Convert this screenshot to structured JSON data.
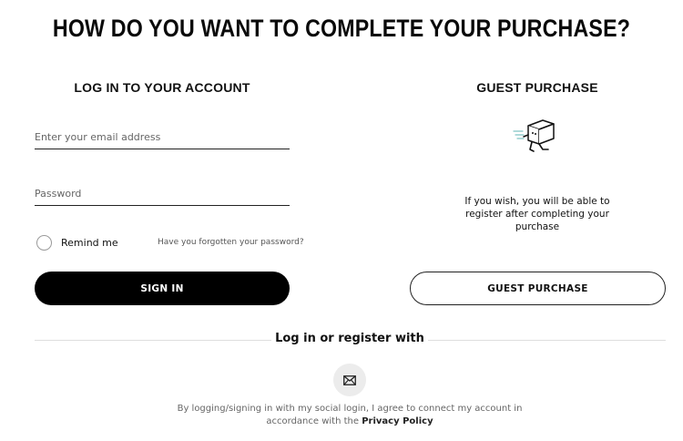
{
  "page": {
    "title": "HOW DO YOU WANT TO COMPLETE YOUR PURCHASE?"
  },
  "login": {
    "heading": "LOG IN TO YOUR ACCOUNT",
    "email_placeholder": "Enter your email address",
    "password_placeholder": "Password",
    "remind_me_label": "Remind me",
    "remind_me_checked": false,
    "forgot_password_link": "Have you forgotten your password?",
    "sign_in_button": "SIGN IN"
  },
  "guest": {
    "heading": "GUEST PURCHASE",
    "illustration_icon": "running-box-icon",
    "description": "If you wish, you will be able to register after completing your purchase",
    "button": "GUEST PURCHASE"
  },
  "social": {
    "divider_label": "Log in or register with",
    "providers": [
      {
        "icon": "mail-icon"
      }
    ],
    "legal_text": "By logging/signing in with my social login, I agree to connect my account in accordance with the",
    "privacy_policy_link": "Privacy Policy"
  },
  "colors": {
    "primary_button_bg": "#000000",
    "primary_button_text": "#ffffff",
    "divider": "#dedede",
    "social_button_bg": "#ececec"
  }
}
